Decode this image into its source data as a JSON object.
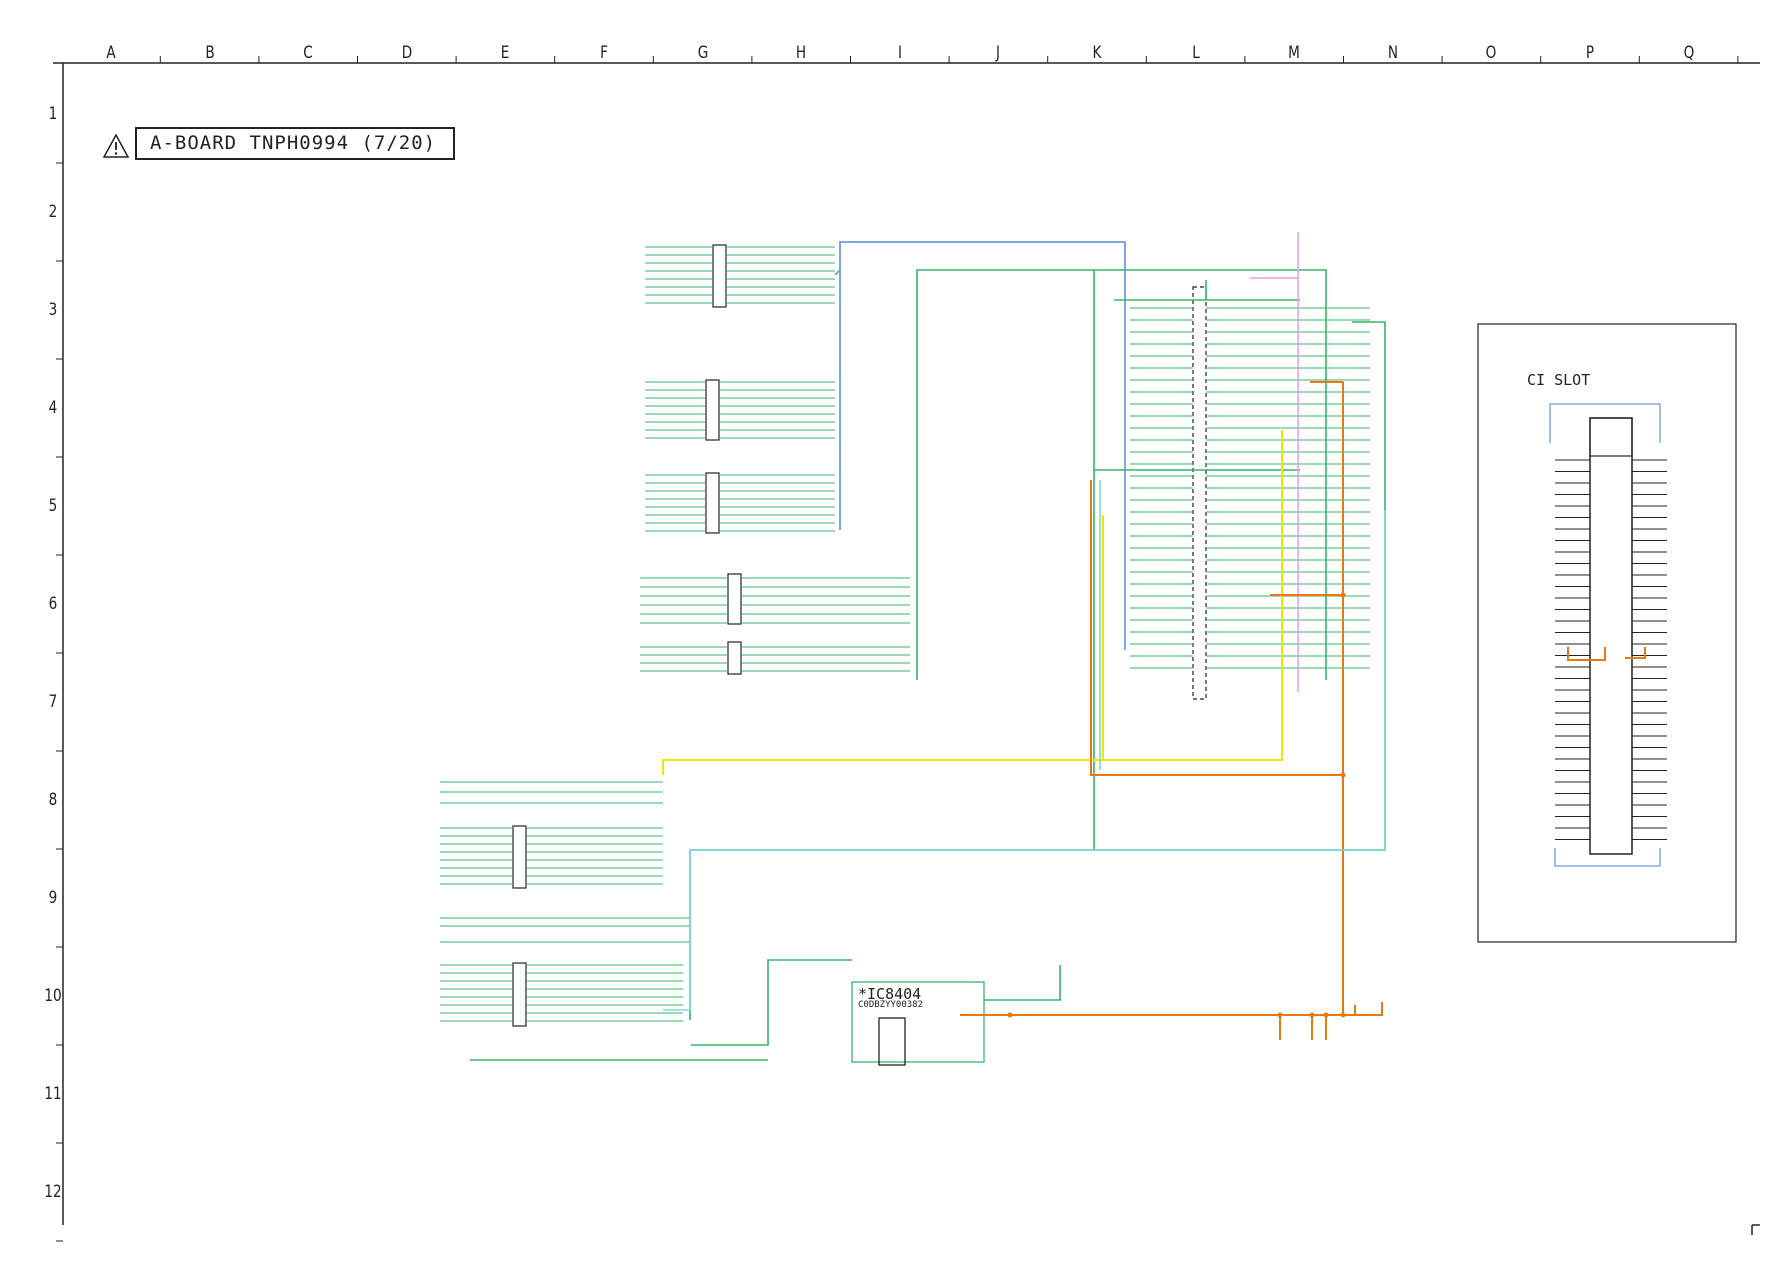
{
  "sheet": {
    "title": "A-BOARD TNPH0994 (7/20)",
    "warning_icon": "warning-triangle-icon",
    "columns": [
      "A",
      "B",
      "C",
      "D",
      "E",
      "F",
      "G",
      "H",
      "I",
      "J",
      "K",
      "L",
      "M",
      "N",
      "O",
      "P",
      "Q"
    ],
    "rows": [
      "1",
      "2",
      "3",
      "4",
      "5",
      "6",
      "7",
      "8",
      "9",
      "10",
      "11",
      "12"
    ]
  },
  "components": {
    "slot_label": "CI SLOT",
    "ic_label": "*IC8404",
    "ic_sub": "C0DBZYY00382"
  },
  "colors": {
    "blue": "#6f9be0",
    "green": "#35b66b",
    "pink": "#ee9ce6",
    "orange": "#e57a10",
    "yellow": "#f2e600",
    "cyan": "#7fd8d8",
    "ink": "#2a2a2a"
  }
}
